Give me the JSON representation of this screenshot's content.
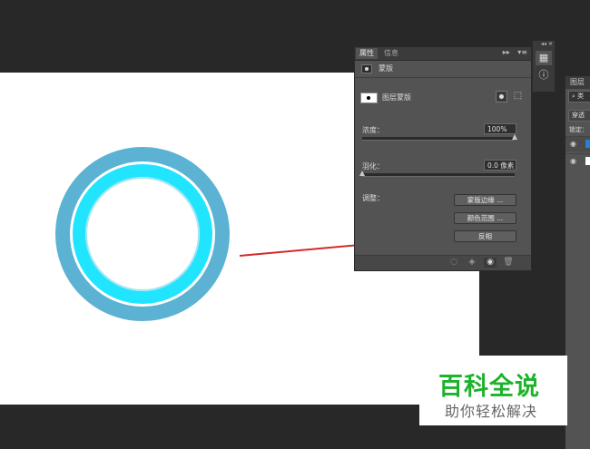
{
  "properties_panel": {
    "tabs": [
      {
        "label": "属性",
        "active": true
      },
      {
        "label": "信息",
        "active": false
      }
    ],
    "tab_controls": {
      "collapse": "▸▸",
      "menu": "▾≡"
    },
    "section_title": "蒙版",
    "mask_type_label": "图层蒙版",
    "density": {
      "label": "浓度：",
      "value": "100%",
      "percent": 100
    },
    "feather": {
      "label": "羽化：",
      "value": "0.0 像素",
      "percent": 0
    },
    "adjust": {
      "label": "调整：",
      "buttons": [
        "蒙版边缘 ...",
        "颜色范围 ...",
        "反相"
      ]
    }
  },
  "mini_strip": {
    "controls": "◂◂  ✕",
    "icons": [
      "properties-icon",
      "info-icon"
    ]
  },
  "layers_panel": {
    "tab_label": "图层",
    "search_placeholder": "类",
    "blend_mode": "穿透",
    "lock_label": "锁定："
  },
  "canvas": {
    "background": "#ffffff",
    "ring_outer_color": "#5bb2d3",
    "ring_inner_color": "#21e4ff",
    "arrow_color": "#d42a2a"
  },
  "watermark": {
    "title": "百科全说",
    "subtitle": "助你轻松解决",
    "title_color": "#1bb32a"
  }
}
